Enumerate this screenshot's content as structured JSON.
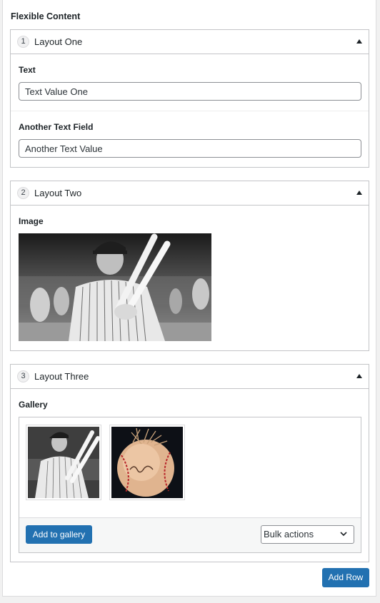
{
  "flexible_content": {
    "label": "Flexible Content"
  },
  "layouts": [
    {
      "number": "1",
      "title": "Layout One",
      "fields": [
        {
          "label": "Text",
          "value": "Text Value One"
        },
        {
          "label": "Another Text Field",
          "value": "Another Text Value"
        }
      ]
    },
    {
      "number": "2",
      "title": "Layout Two",
      "image_label": "Image"
    },
    {
      "number": "3",
      "title": "Layout Three",
      "gallery_label": "Gallery",
      "add_to_gallery": "Add to gallery",
      "bulk_actions": "Bulk actions"
    }
  ],
  "add_row": "Add Row",
  "colors": {
    "primary": "#2271b1",
    "border": "#c3c4c7"
  },
  "icons": [
    "collapse-caret-icon",
    "chevron-down-icon"
  ]
}
